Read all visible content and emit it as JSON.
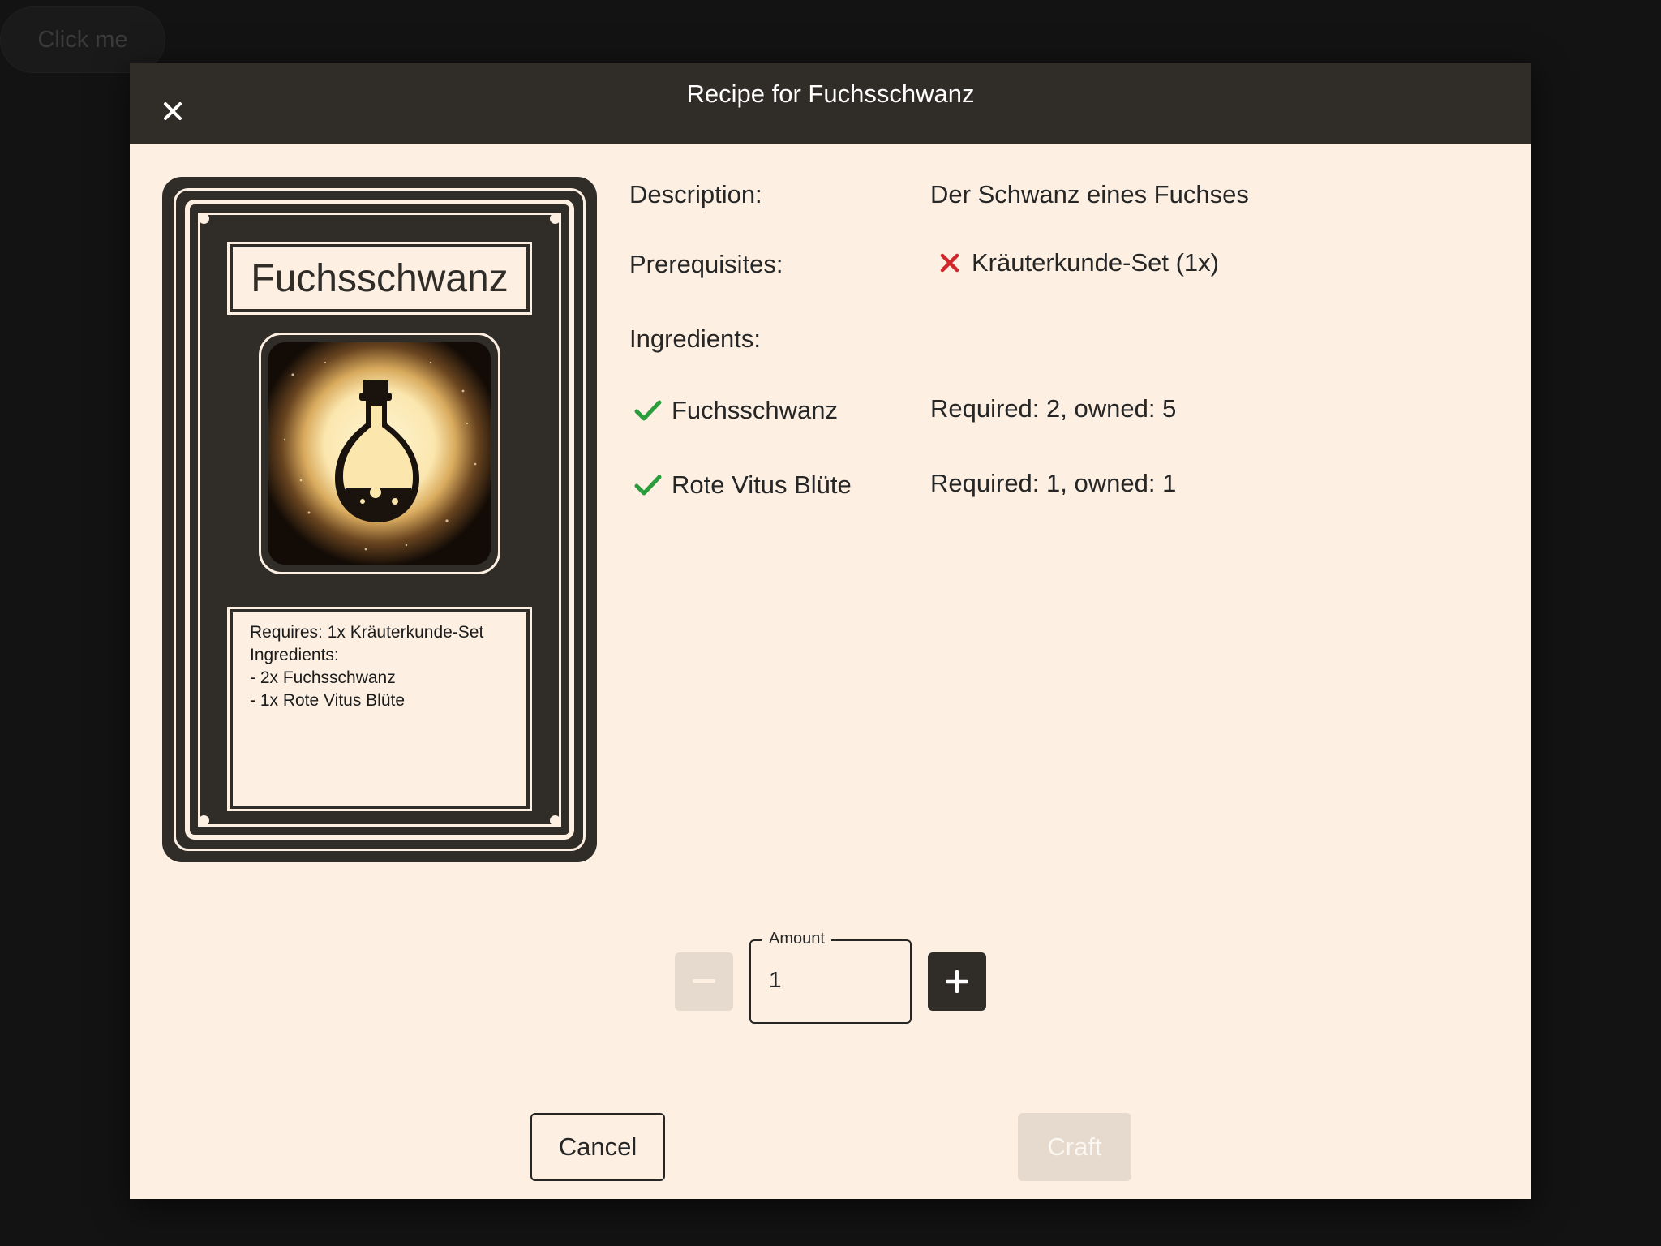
{
  "background_button": {
    "label": "Click me"
  },
  "dialog": {
    "title": "Recipe for Fuchsschwanz",
    "close_icon": "close-icon"
  },
  "card": {
    "title": "Fuchsschwanz",
    "image": "potion-bottle-icon",
    "text_lines": [
      "Requires: 1x Kräuterkunde-Set",
      "Ingredients:",
      "- 2x Fuchsschwanz",
      "- 1x Rote Vitus Blüte"
    ]
  },
  "details": {
    "description_label": "Description:",
    "description_value": "Der Schwanz eines Fuchses",
    "prerequisites_label": "Prerequisites:",
    "prerequisites": [
      {
        "name": "Kräuterkunde-Set (1x)",
        "met": false
      }
    ],
    "ingredients_label": "Ingredients:",
    "ingredients": [
      {
        "name": "Fuchsschwanz",
        "status": "Required: 2, owned: 5",
        "met": true
      },
      {
        "name": "Rote Vitus Blüte",
        "status": "Required: 1, owned: 1",
        "met": true
      }
    ]
  },
  "amount": {
    "label": "Amount",
    "value": "1"
  },
  "actions": {
    "cancel_label": "Cancel",
    "craft_label": "Craft"
  },
  "colors": {
    "dialog_bg": "#fdf0e3",
    "header_bg": "#302c28",
    "check_green": "#2a9d3c",
    "cross_red": "#d0282a",
    "disabled_bg": "#e5dacd"
  }
}
